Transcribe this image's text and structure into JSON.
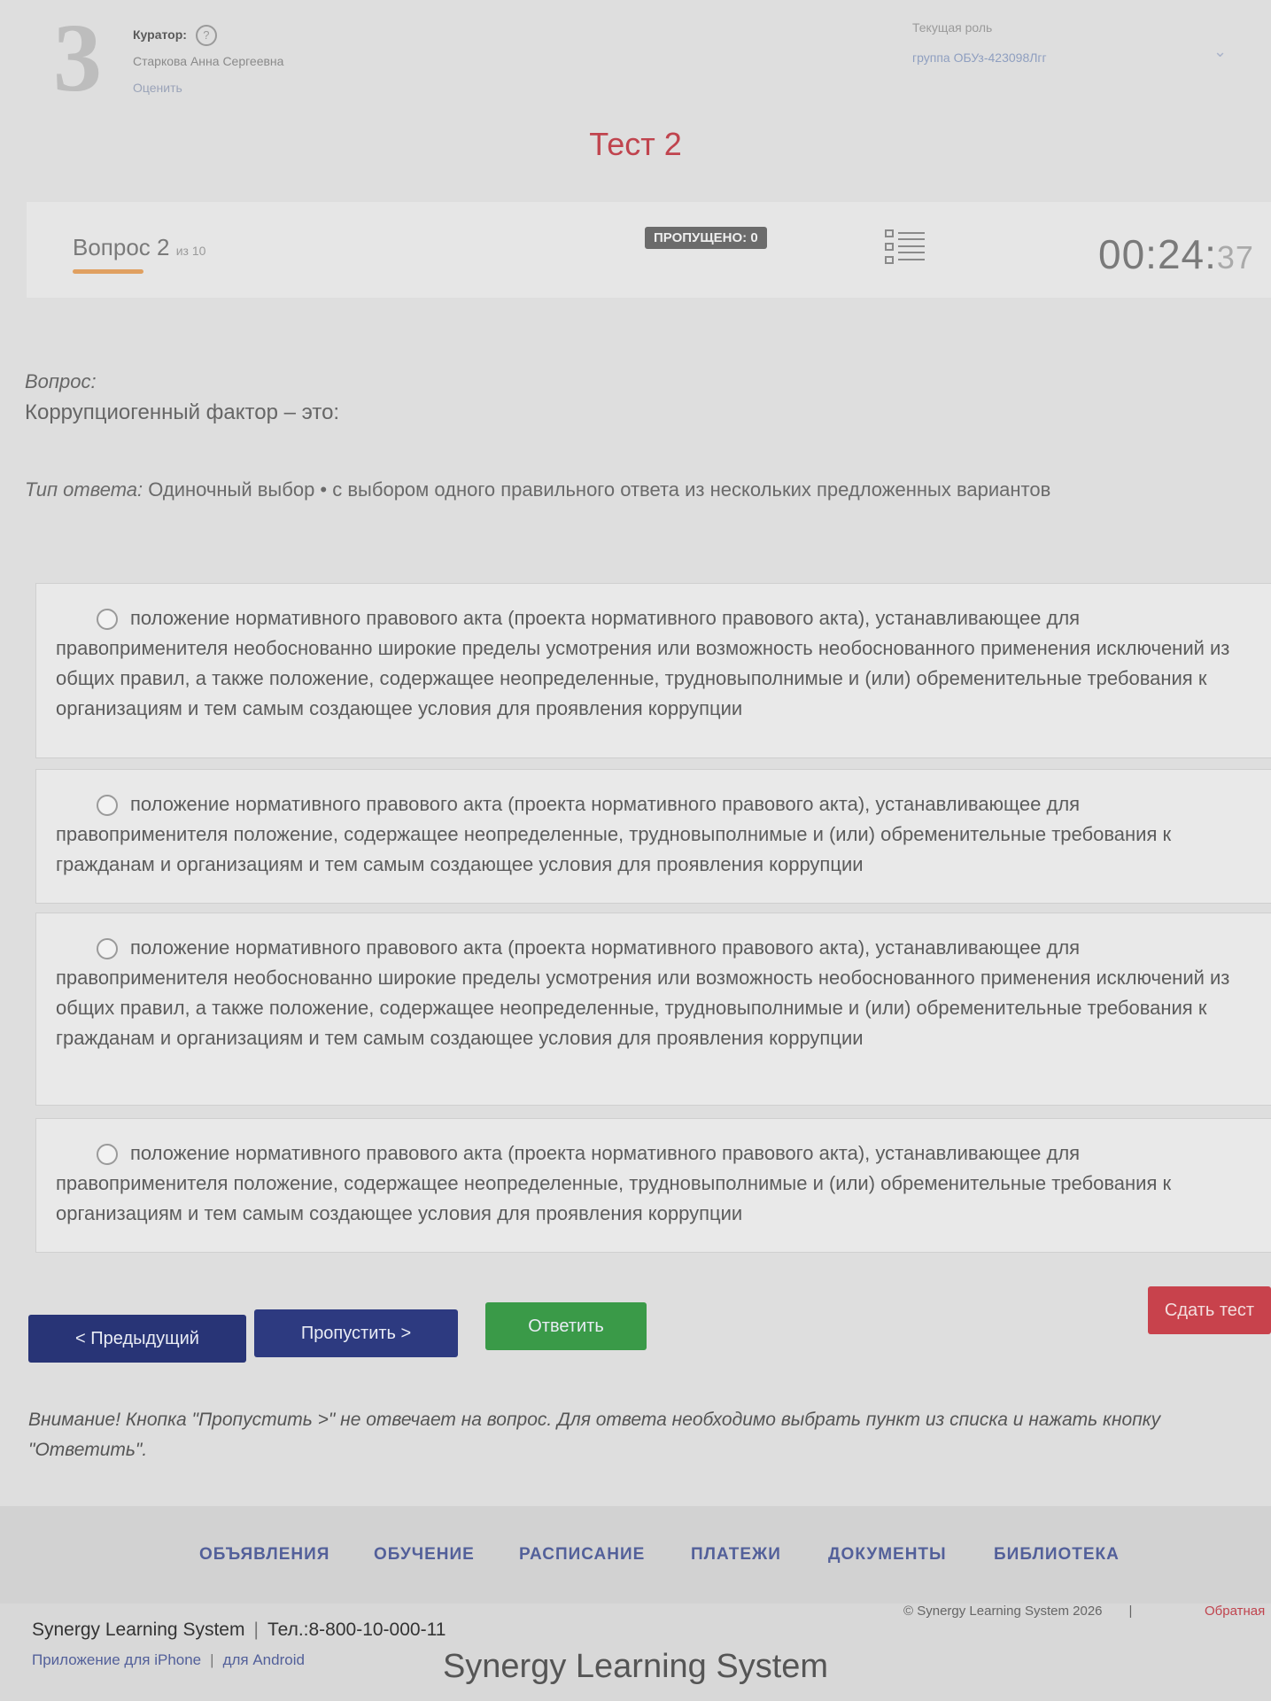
{
  "header": {
    "curator_label": "Куратор:",
    "help_icon": "question-circle-icon",
    "curator_name": "Старкова Анна Сергеевна",
    "rate_link": "Оценить",
    "role_label": "Текущая роль",
    "role_value": "группа ОБУз-423098Лгг",
    "chevron_icon": "chevron-down-icon"
  },
  "test_title": "Тест 2",
  "question_bar": {
    "question_label": "Вопрос 2",
    "question_of": "из 10",
    "skipped": "ПРОПУЩЕНО: 0",
    "list_icon": "question-list-icon",
    "timer_main": "00:24:",
    "timer_seconds": "37"
  },
  "question": {
    "label": "Вопрос:",
    "text": "Коррупциогенный фактор – это:",
    "answer_type_label": "Тип ответа:",
    "answer_type_value": "Одиночный выбор • с выбором одного правильного ответа из нескольких предложенных вариантов"
  },
  "options": [
    "положение нормативного правового акта (проекта нормативного правового акта), устанавливающее для правоприменителя необоснованно широкие пределы усмотрения или возможность необоснованного применения исключений из общих правил, а также положение, содержащее неопределенные, трудновыполнимые и (или) обременительные требования к организациям и тем самым создающее условия для проявления коррупции",
    "положение нормативного правового акта (проекта нормативного правового акта), устанавливающее для правоприменителя положение, содержащее неопределенные, трудновыполнимые и (или) обременительные требования к гражданам и организациям и тем самым создающее условия для проявления коррупции",
    "положение нормативного правового акта (проекта нормативного правового акта), устанавливающее для правоприменителя необоснованно широкие пределы усмотрения или возможность необоснованного применения исключений из общих правил, а также положение, содержащее неопределенные, трудновыполнимые и (или) обременительные требования к гражданам и организациям и тем самым создающее условия для проявления коррупции",
    "положение нормативного правового акта (проекта нормативного правового акта), устанавливающее для правоприменителя положение, содержащее неопределенные, трудновыполнимые и (или) обременительные требования к организациям и тем самым создающее условия для проявления коррупции"
  ],
  "buttons": {
    "prev": "< Предыдущий",
    "skip": "Пропустить >",
    "answer": "Ответить",
    "submit": "Сдать тест"
  },
  "warning": "Внимание! Кнопка \"Пропустить >\" не отвечает на вопрос. Для ответа необходимо выбрать пункт из списка и нажать кнопку \"Ответить\".",
  "footer": {
    "nav": [
      "ОБЪЯВЛЕНИЯ",
      "ОБУЧЕНИЕ",
      "РАСПИСАНИЕ",
      "ПЛАТЕЖИ",
      "ДОКУМЕНТЫ",
      "БИБЛИОТЕКА"
    ],
    "brand": "Synergy Learning System",
    "phone": "Тел.:8-800-10-000-11",
    "apps_iphone": "Приложение для iPhone",
    "apps_android": "для Android",
    "copyright": "© Synergy Learning System 2026",
    "feedback": "Обратная",
    "brand_big": "Synergy Learning System"
  },
  "colors": {
    "title": "#c0444e",
    "nav_button": "#283476",
    "answer_button": "#3a9a48",
    "submit_button": "#c8424c"
  }
}
